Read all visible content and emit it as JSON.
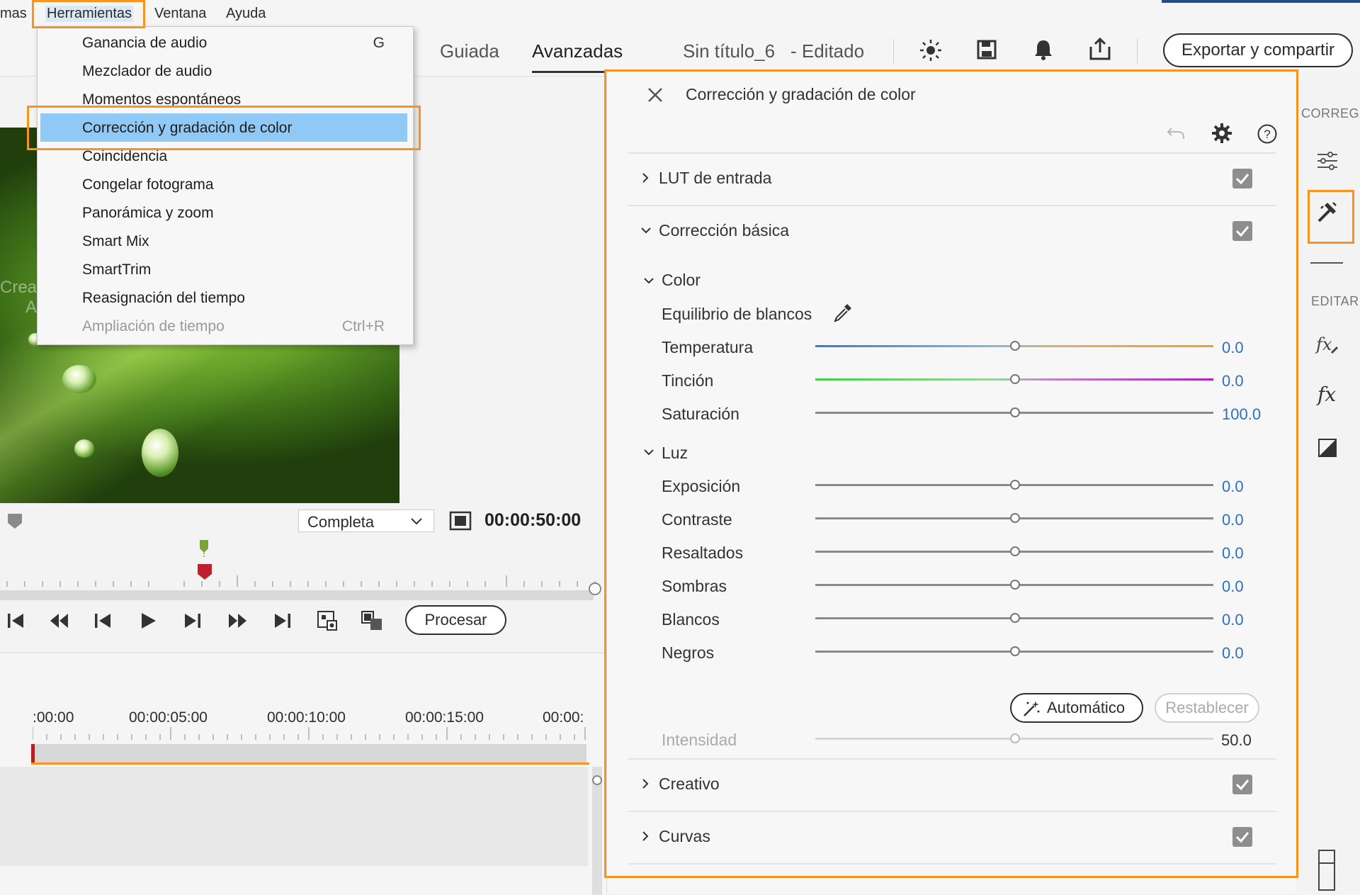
{
  "menubar": {
    "items": [
      "mas",
      "Herramientas",
      "Ventana",
      "Ayuda"
    ]
  },
  "topbar": {
    "tabs": [
      "Guiada",
      "Avanzadas"
    ],
    "active_tab": "Avanzadas",
    "doc_title": "Sin título_6",
    "doc_status": "- Editado",
    "export_label": "Exportar y compartir"
  },
  "tools_menu": {
    "items": [
      {
        "label": "Ganancia de audio",
        "shortcut": "G"
      },
      {
        "label": "Mezclador de audio",
        "shortcut": ""
      },
      {
        "label": "Momentos espontáneos",
        "shortcut": ""
      },
      {
        "label": "Corrección y gradación de color",
        "shortcut": "",
        "selected": true
      },
      {
        "label": "Coincidencia",
        "shortcut": ""
      },
      {
        "label": "Congelar fotograma",
        "shortcut": ""
      },
      {
        "label": "Panorámica y zoom",
        "shortcut": ""
      },
      {
        "label": "Smart Mix",
        "shortcut": ""
      },
      {
        "label": "SmartTrim",
        "shortcut": ""
      },
      {
        "label": "Reasignación del tiempo",
        "shortcut": ""
      },
      {
        "label": "Ampliación de tiempo",
        "shortcut": "Ctrl+R",
        "disabled": true
      }
    ]
  },
  "video": {
    "overlay_text": "Crea",
    "overlay_text2": "A"
  },
  "monitor": {
    "quality": "Completa",
    "timecode": "00:00:50:00",
    "process_label": "Procesar"
  },
  "timeline": {
    "ruler_labels": [
      ":00:00",
      "00:00:05:00",
      "00:00:10:00",
      "00:00:15:00",
      "00:00:"
    ]
  },
  "color_panel": {
    "title": "Corrección y gradación de color",
    "sections": {
      "lut": "LUT de entrada",
      "basic": "Corrección básica",
      "color": "Color",
      "white_balance": "Equilibrio de blancos",
      "light": "Luz",
      "creative": "Creativo",
      "curves": "Curvas"
    },
    "color_sliders": [
      {
        "label": "Temperatura",
        "value": "0.0"
      },
      {
        "label": "Tinción",
        "value": "0.0"
      },
      {
        "label": "Saturación",
        "value": "100.0"
      }
    ],
    "light_sliders": [
      {
        "label": "Exposición",
        "value": "0.0"
      },
      {
        "label": "Contraste",
        "value": "0.0"
      },
      {
        "label": "Resaltados",
        "value": "0.0"
      },
      {
        "label": "Sombras",
        "value": "0.0"
      },
      {
        "label": "Blancos",
        "value": "0.0"
      },
      {
        "label": "Negros",
        "value": "0.0"
      }
    ],
    "auto_label": "Automático",
    "reset_label": "Restablecer",
    "intensity_label": "Intensidad",
    "intensity_value": "50.0"
  },
  "rail": {
    "correct_label": "CORREGI",
    "edit_label": "EDITAR"
  },
  "colors": {
    "highlight": "#f7941d",
    "selection": "#90c8f6",
    "value_blue": "#2d6fc0"
  }
}
